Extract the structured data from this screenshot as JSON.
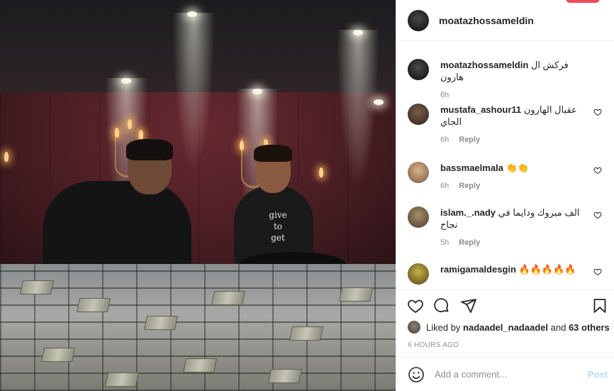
{
  "post": {
    "author": "moatazhossameldin",
    "shirt_text": [
      "give",
      "to",
      "get"
    ]
  },
  "comments": [
    {
      "username": "moatazhossameldin",
      "text": "فركش ال هارون",
      "time": "6h",
      "reply": "",
      "liked_icon": false
    },
    {
      "username": "mustafa_ashour11",
      "text": "عقبال الهارون الجاي",
      "time": "6h",
      "reply": "Reply",
      "liked_icon": true
    },
    {
      "username": "bassmaelmala",
      "text": "👏👏",
      "time": "6h",
      "reply": "Reply",
      "liked_icon": true
    },
    {
      "username": "islam._.nady",
      "text": "الف مبروك ودايما في نجاح",
      "time": "5h",
      "reply": "Reply",
      "liked_icon": true
    },
    {
      "username": "ramigamaldesgin",
      "text": "🔥🔥🔥🔥🔥",
      "time": "",
      "reply": "",
      "liked_icon": true
    }
  ],
  "likes": {
    "prefix": "Liked by ",
    "user": "nadaadel_nadaadel",
    "middle": " and ",
    "others": "63 others"
  },
  "timestamp": "6 HOURS AGO",
  "add_comment": {
    "placeholder": "Add a comment...",
    "post_label": "Post"
  },
  "icons": [
    "heart-icon",
    "comment-icon",
    "share-icon",
    "bookmark-icon",
    "emoji-icon"
  ],
  "colors": {
    "accent_disabled": "#b2dffc",
    "muted": "#8e8e8e",
    "text": "#262626",
    "badge": "#ed4956"
  }
}
